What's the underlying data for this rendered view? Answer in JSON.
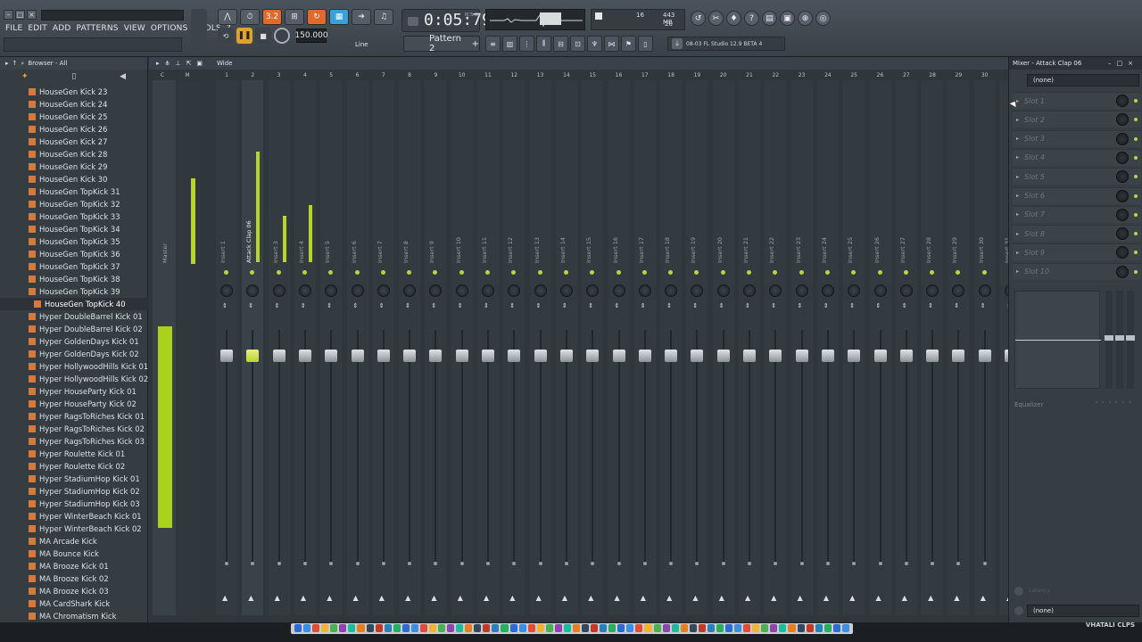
{
  "app": {
    "menu": [
      "FILE",
      "EDIT",
      "ADD",
      "PATTERNS",
      "VIEW",
      "OPTIONS",
      "TOOLS",
      "?"
    ],
    "time": "0:05:79",
    "time_unit": "M:S:CS",
    "tempo": "150.000",
    "pattern": "Pattern 2",
    "snap": "Line",
    "cpu_a": "16",
    "cpu_mem": "443 MB",
    "cpu_poly": "20",
    "news": "08-03  FL Studio 12.9 BETA 4",
    "accent": "#b8d42c"
  },
  "browser": {
    "title": "Browser - All",
    "selected_index": 17,
    "items": [
      "HouseGen Kick 23",
      "HouseGen Kick 24",
      "HouseGen Kick 25",
      "HouseGen Kick 26",
      "HouseGen Kick 27",
      "HouseGen Kick 28",
      "HouseGen Kick 29",
      "HouseGen Kick 30",
      "HouseGen TopKick 31",
      "HouseGen TopKick 32",
      "HouseGen TopKick 33",
      "HouseGen TopKick 34",
      "HouseGen TopKick 35",
      "HouseGen TopKick 36",
      "HouseGen TopKick 37",
      "HouseGen TopKick 38",
      "HouseGen TopKick 39",
      "HouseGen TopKick 40",
      "Hyper DoubleBarrel Kick 01",
      "Hyper DoubleBarrel Kick 02",
      "Hyper GoldenDays Kick 01",
      "Hyper GoldenDays Kick 02",
      "Hyper HollywoodHills Kick 01",
      "Hyper HollywoodHills Kick 02",
      "Hyper HouseParty Kick 01",
      "Hyper HouseParty Kick 02",
      "Hyper RagsToRiches Kick 01",
      "Hyper RagsToRiches Kick 02",
      "Hyper RagsToRiches Kick 03",
      "Hyper Roulette Kick 01",
      "Hyper Roulette Kick 02",
      "Hyper StadiumHop Kick 01",
      "Hyper StadiumHop Kick 02",
      "Hyper StadiumHop Kick 03",
      "Hyper WinterBeach Kick 01",
      "Hyper WinterBeach Kick 02",
      "MA Arcade Kick",
      "MA Bounce Kick",
      "MA Brooze Kick 01",
      "MA Brooze Kick 02",
      "MA Brooze Kick 03",
      "MA CardShark Kick",
      "MA Chromatism Kick"
    ]
  },
  "mixer": {
    "view_mode": "Wide",
    "track_numbers": [
      "C",
      "M",
      "1",
      "2",
      "3",
      "4",
      "5",
      "6",
      "7",
      "8",
      "9",
      "10",
      "11",
      "12",
      "13",
      "14",
      "15",
      "16",
      "17",
      "18",
      "19",
      "20",
      "21",
      "22",
      "23",
      "24",
      "25",
      "26",
      "27",
      "28",
      "29",
      "30"
    ],
    "master_label": "Master",
    "tracks": [
      {
        "name": "Insert 1",
        "level": 0
      },
      {
        "name": "Attack Clap 06",
        "level": 0.62,
        "selected": true
      },
      {
        "name": "Insert 3",
        "level": 0.26
      },
      {
        "name": "Insert 4",
        "level": 0.32
      },
      {
        "name": "Insert 5",
        "level": 0
      },
      {
        "name": "Insert 6",
        "level": 0
      },
      {
        "name": "Insert 7",
        "level": 0
      },
      {
        "name": "Insert 8",
        "level": 0
      },
      {
        "name": "Insert 9",
        "level": 0
      },
      {
        "name": "Insert 10",
        "level": 0
      },
      {
        "name": "Insert 11",
        "level": 0
      },
      {
        "name": "Insert 12",
        "level": 0
      },
      {
        "name": "Insert 13",
        "level": 0
      },
      {
        "name": "Insert 14",
        "level": 0
      },
      {
        "name": "Insert 15",
        "level": 0
      },
      {
        "name": "Insert 16",
        "level": 0
      },
      {
        "name": "Insert 17",
        "level": 0
      },
      {
        "name": "Insert 18",
        "level": 0
      },
      {
        "name": "Insert 19",
        "level": 0
      },
      {
        "name": "Insert 20",
        "level": 0
      },
      {
        "name": "Insert 21",
        "level": 0
      },
      {
        "name": "Insert 22",
        "level": 0
      },
      {
        "name": "Insert 23",
        "level": 0
      },
      {
        "name": "Insert 24",
        "level": 0
      },
      {
        "name": "Insert 25",
        "level": 0
      },
      {
        "name": "Insert 26",
        "level": 0
      },
      {
        "name": "Insert 27",
        "level": 0
      },
      {
        "name": "Insert 28",
        "level": 0
      },
      {
        "name": "Insert 29",
        "level": 0
      },
      {
        "name": "Insert 30",
        "level": 0
      },
      {
        "name": "Insert 31",
        "level": 0
      }
    ]
  },
  "mixer_panel": {
    "title": "Mixer - Attack Clap 06",
    "input": "(none)",
    "slots": [
      "Slot 1",
      "Slot 2",
      "Slot 3",
      "Slot 4",
      "Slot 5",
      "Slot 6",
      "Slot 7",
      "Slot 8",
      "Slot 9",
      "Slot 10"
    ],
    "eq_label": "Equalizer",
    "output_label": "(none)",
    "latency_label": "Latency"
  },
  "taskbar": {
    "brand": "VHATALI CLPS"
  }
}
